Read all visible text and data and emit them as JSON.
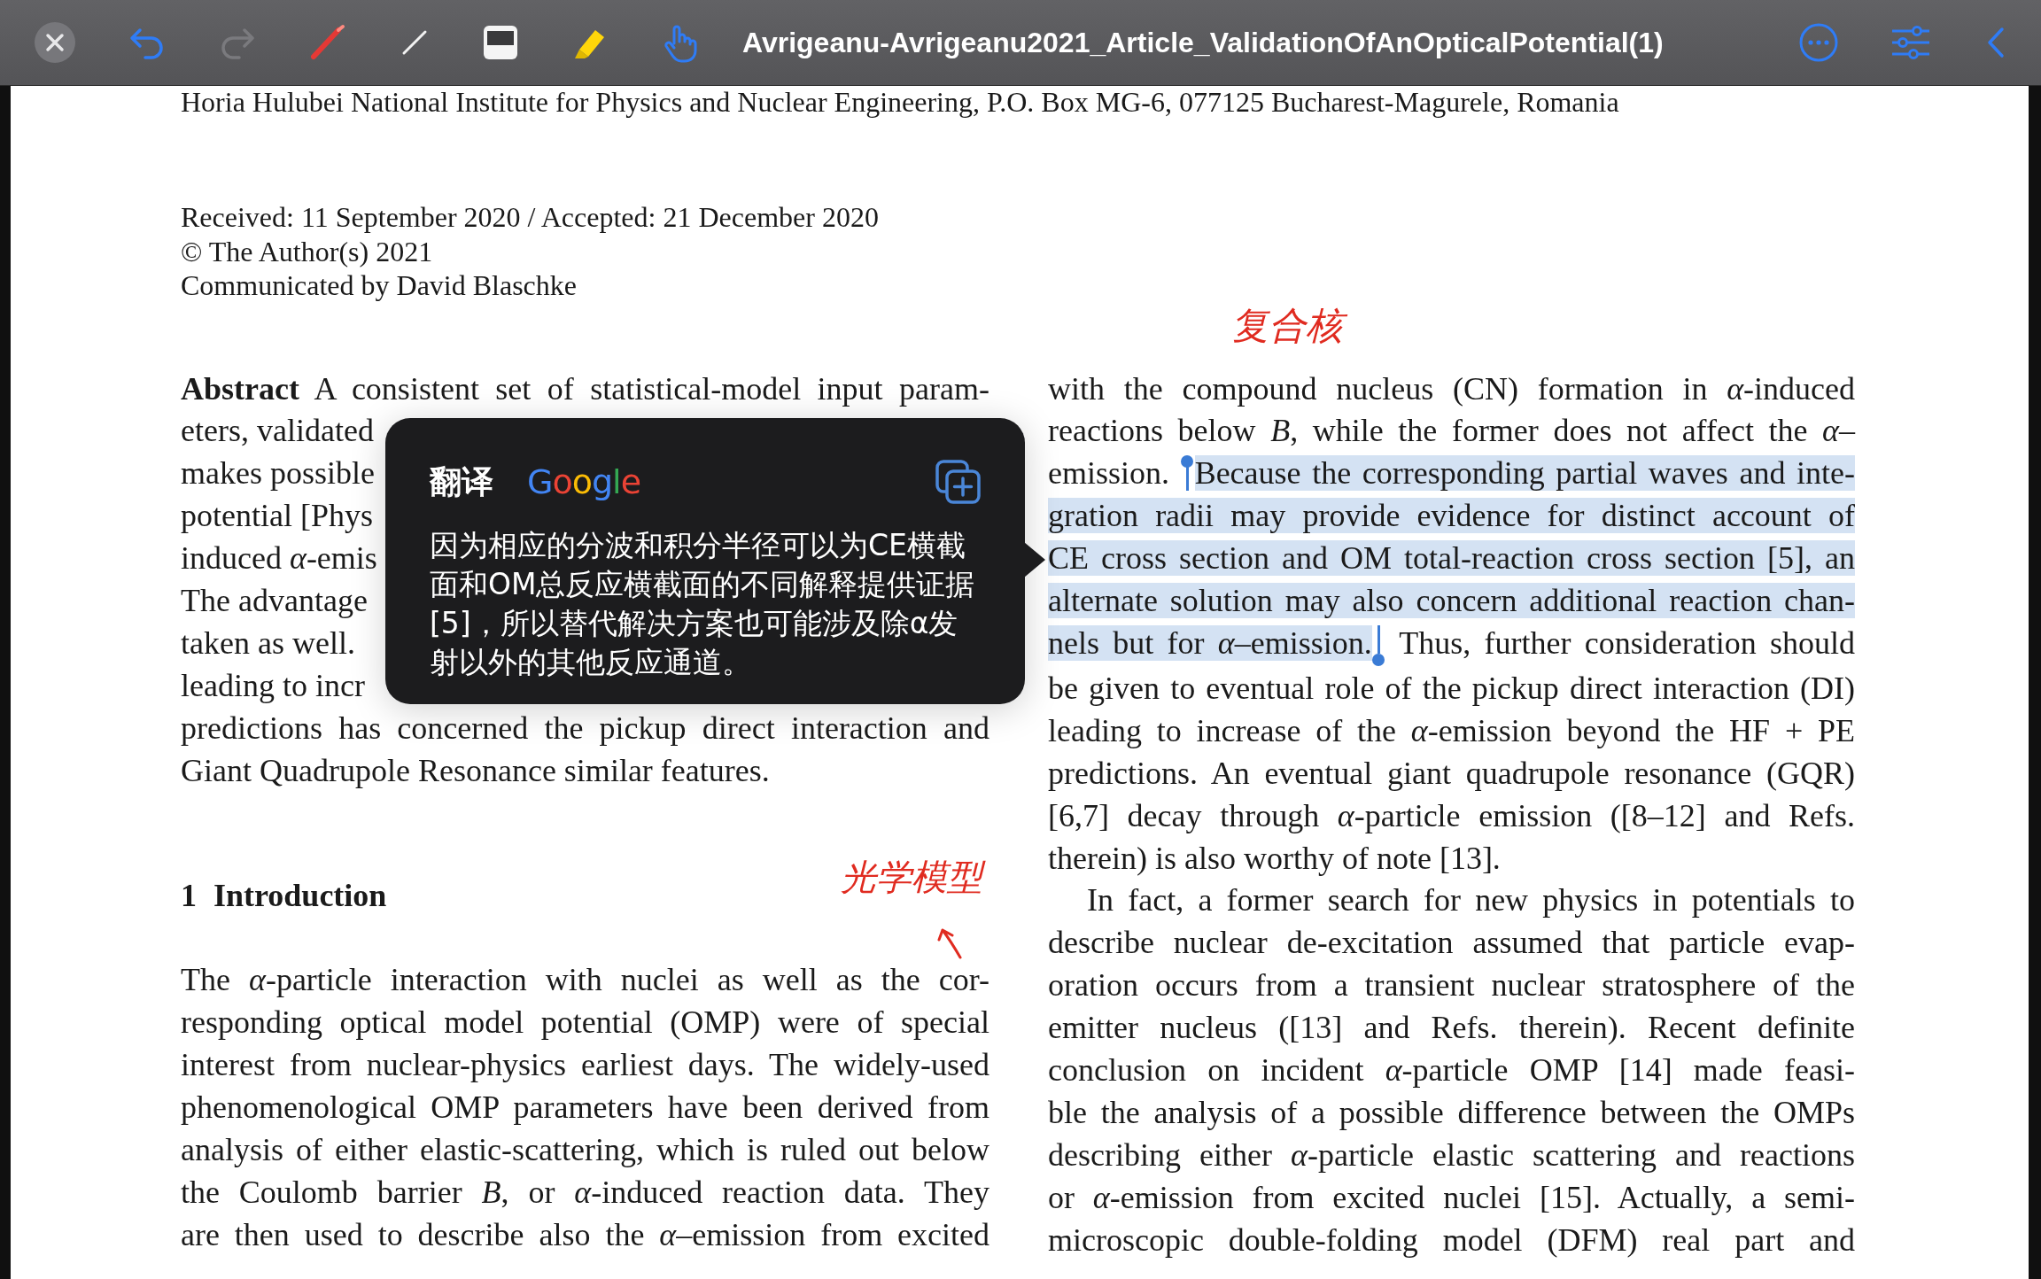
{
  "toolbar": {
    "title": "Avrigeanu-Avrigeanu2021_Article_ValidationOfAnOpticalPotential(1)"
  },
  "page": {
    "affiliation": "Horia Hulubei National Institute for Physics and Nuclear Engineering, P.O. Box MG-6, 077125 Bucharest-Magurele, Romania",
    "history": [
      "Received: 11 September 2020 / Accepted: 21 December 2020",
      "© The Author(s) 2021",
      "Communicated by David Blaschke"
    ],
    "left_column": {
      "abstract": {
        "ends": true,
        "lines": [
          {
            "text": "**Abstract** A consistent set of statistical-model input param-"
          },
          {
            "text": "eters, validated",
            "covered": true
          },
          {
            "text": "makes possible",
            "covered": true
          },
          {
            "text": "potential [Phys",
            "covered": true
          },
          {
            "text": "induced *α*-emis",
            "covered": true
          },
          {
            "text": "The advantage",
            "covered": true
          },
          {
            "text": "taken as well.",
            "covered": true
          },
          {
            "text": "leading to incr",
            "covered": true
          },
          {
            "text": "predictions has concerned the pickup direct interaction and"
          },
          {
            "text": "Giant Quadrupole Resonance similar features."
          }
        ]
      },
      "heading": "1 Introduction",
      "paragraph": {
        "ends": false,
        "lines": [
          "The *α*-particle interaction with nuclei as well as the cor-",
          "responding optical model potential (OMP) were of special",
          "interest from nuclear-physics earliest days. The widely-used",
          "phenomenological OMP parameters have been derived from",
          "analysis of either elastic-scattering, which is ruled out below",
          "the Coulomb barrier *B*, or *α*-induced reaction data. They",
          "are then used to describe also the *α*–emission from excited"
        ]
      }
    },
    "right_column": {
      "paragraphs": [
        {
          "indent": false,
          "ends": true,
          "lines": [
            [
              {
                "text": "with the compound nucleus (CN) formation in *α*-induced",
                "selected": false
              }
            ],
            [
              {
                "text": "reactions below *B*, while the former does not affect the *α*–",
                "selected": false
              }
            ],
            [
              {
                "text": "emission. ",
                "selected": false
              },
              {
                "text": "Because the corresponding partial waves and inte-",
                "selected": true
              }
            ],
            [
              {
                "text": "gration radii may provide evidence for distinct account of",
                "selected": true
              }
            ],
            [
              {
                "text": "CE cross section and OM total-reaction cross section [5], an",
                "selected": true
              }
            ],
            [
              {
                "text": "alternate solution may also concern additional reaction chan-",
                "selected": true
              }
            ],
            [
              {
                "text": "nels but for *α*–emission.",
                "selected": true
              },
              {
                "text": " Thus, further consideration should",
                "selected": false
              }
            ],
            [
              {
                "text": "be given to eventual role of the pickup direct interaction (DI)",
                "selected": false
              }
            ],
            [
              {
                "text": "leading to increase of the *α*-emission beyond the HF + PE",
                "selected": false
              }
            ],
            [
              {
                "text": "predictions. An eventual giant quadrupole resonance (GQR)",
                "selected": false
              }
            ],
            [
              {
                "text": "[6,7] decay through *α*-particle emission ([8–12] and Refs.",
                "selected": false
              }
            ],
            [
              {
                "text": "therein) is also worthy of note [13].",
                "selected": false
              }
            ]
          ]
        },
        {
          "indent": true,
          "ends": false,
          "lines": [
            [
              {
                "text": "In fact, a former search for new physics in potentials to",
                "selected": false
              }
            ],
            [
              {
                "text": "describe nuclear de-excitation assumed that particle evap-",
                "selected": false
              }
            ],
            [
              {
                "text": "oration occurs from a transient nuclear stratosphere of the",
                "selected": false
              }
            ],
            [
              {
                "text": "emitter nucleus ([13] and Refs. therein). Recent definite",
                "selected": false
              }
            ],
            [
              {
                "text": "conclusion on incident *α*-particle OMP [14] made feasi-",
                "selected": false
              }
            ],
            [
              {
                "text": "ble the analysis of a possible difference between the OMPs",
                "selected": false
              }
            ],
            [
              {
                "text": "describing either *α*-particle elastic scattering and reactions",
                "selected": false
              }
            ],
            [
              {
                "text": "or *α*-emission from excited nuclei [15]. Actually, a semi-",
                "selected": false
              }
            ],
            [
              {
                "text": "microscopic double-folding model (DFM) real part and",
                "selected": false
              }
            ]
          ]
        }
      ]
    },
    "handwritten_notes": [
      "复合核",
      "光学模型"
    ]
  },
  "translation_popup": {
    "title": "翻译",
    "provider": "Google",
    "text": "因为相应的分波和积分半径可以为CE横截面和OM总反应横截面的不同解释提供证据[5]，所以替代解决方案也可能涉及除α发射以外的其他反应通道。"
  }
}
